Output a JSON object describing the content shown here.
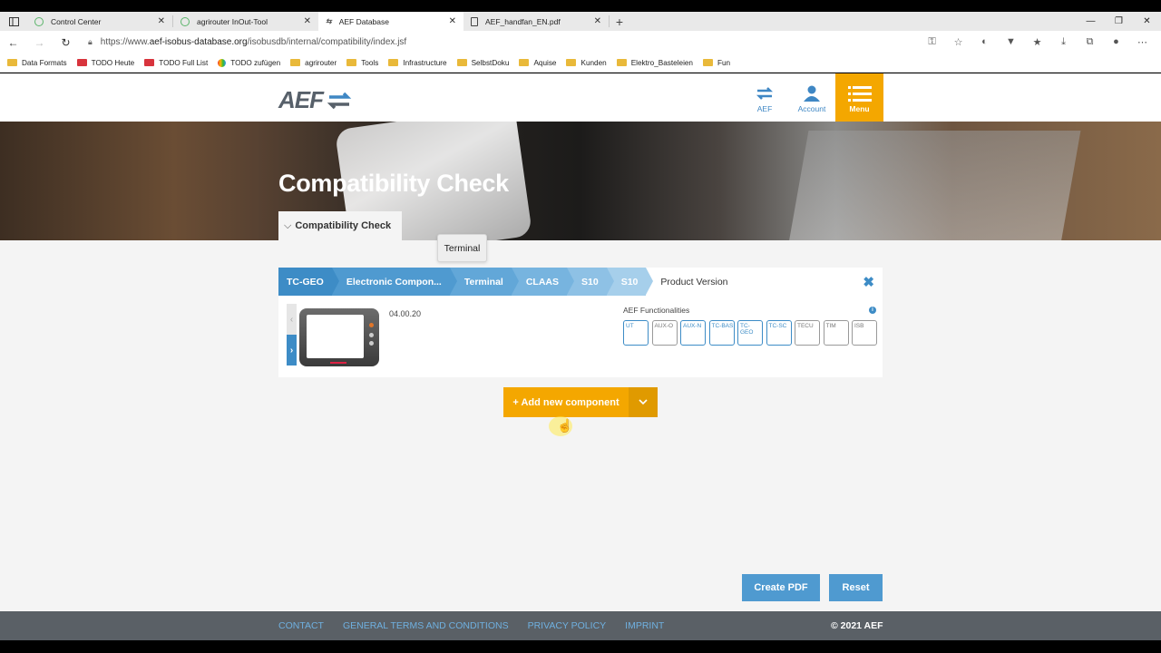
{
  "browser": {
    "tabs": [
      {
        "title": "Control Center",
        "active": false
      },
      {
        "title": "agrirouter InOut-Tool",
        "active": false
      },
      {
        "title": "AEF Database",
        "active": true
      },
      {
        "title": "AEF_handfan_EN.pdf",
        "active": false
      }
    ],
    "url_prefix": "https://www.",
    "url_host": "aef-isobus-database.org",
    "url_path": "/isobusdb/internal/compatibility/index.jsf",
    "bookmarks": [
      "Data Formats",
      "TODO Heute",
      "TODO Full List",
      "TODO zufügen",
      "agrirouter",
      "Tools",
      "Infrastructure",
      "SelbstDoku",
      "Aquise",
      "Kunden",
      "Elektro_Basteleien",
      "Fun"
    ]
  },
  "header": {
    "logo": "AEF",
    "nav": [
      {
        "label": "AEF"
      },
      {
        "label": "Account"
      },
      {
        "label": "Menu"
      }
    ]
  },
  "hero": {
    "title": "Compatibility Check",
    "crumb_tab": "Compatibility Check"
  },
  "tooltip": "Terminal",
  "card": {
    "breadcrumbs": [
      "TC-GEO",
      "Electronic Compon...",
      "Terminal",
      "CLAAS",
      "S10",
      "S10"
    ],
    "current": "Product Version",
    "version": "04.00.20",
    "functionalities_title": "AEF Functionalities",
    "functionalities": [
      {
        "label": "UT",
        "active": true
      },
      {
        "label": "AUX-O",
        "active": false
      },
      {
        "label": "AUX-N",
        "active": true
      },
      {
        "label": "TC-BAS",
        "active": true
      },
      {
        "label": "TC-GEO",
        "active": true
      },
      {
        "label": "TC-SC",
        "active": true
      },
      {
        "label": "TECU",
        "active": false
      },
      {
        "label": "TIM",
        "active": false
      },
      {
        "label": "ISB",
        "active": false
      }
    ]
  },
  "actions": {
    "add_component": "+ Add new component",
    "create_pdf": "Create PDF",
    "reset": "Reset"
  },
  "footer": {
    "links": [
      "CONTACT",
      "GENERAL TERMS AND CONDITIONS",
      "PRIVACY POLICY",
      "IMPRINT"
    ],
    "copyright": "© 2021 AEF"
  },
  "colors": {
    "accent_orange": "#f4a700",
    "accent_blue": "#3d8cc6",
    "footer_bg": "#5a6066"
  }
}
